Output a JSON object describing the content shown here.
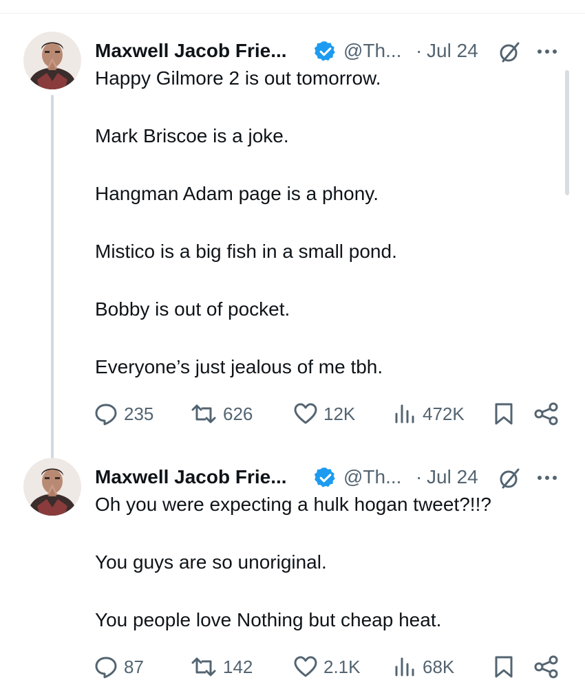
{
  "tweets": [
    {
      "author_name": "Maxwell Jacob Frie...",
      "handle": "@Th...",
      "separator": "·",
      "date": "Jul 24",
      "lines": [
        "Happy Gilmore 2 is out tomorrow.",
        "Mark Briscoe is a joke.",
        "Hangman Adam page is a phony.",
        "Mistico is a big fish in a small pond.",
        "Bobby is out of pocket.",
        "Everyone’s just jealous of me tbh."
      ],
      "replies": "235",
      "reposts": "626",
      "likes": "12K",
      "views": "472K"
    },
    {
      "author_name": "Maxwell Jacob Frie...",
      "handle": "@Th...",
      "separator": "·",
      "date": "Jul 24",
      "lines": [
        "Oh you were expecting a hulk hogan tweet?!!?",
        "You guys are so unoriginal.",
        "You people love Nothing but cheap heat."
      ],
      "replies": "87",
      "reposts": "142",
      "likes": "2.1K",
      "views": "68K"
    }
  ],
  "icons": {
    "verified": "verified-badge-icon",
    "edit": "edited-icon",
    "more": "more-icon",
    "reply": "reply-icon",
    "repost": "repost-icon",
    "like": "like-icon",
    "views": "views-icon",
    "bookmark": "bookmark-icon",
    "share": "share-icon"
  },
  "colors": {
    "text": "#0f1419",
    "secondary": "#536471",
    "verified": "#1d9bf0",
    "thread_line": "#cfd9de"
  }
}
